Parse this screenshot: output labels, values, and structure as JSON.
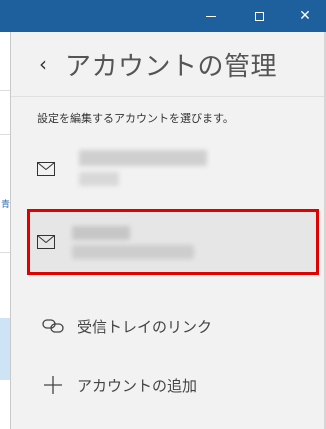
{
  "window": {
    "controls": {
      "minimize_icon": "minimize-icon",
      "maximize_icon": "maximize-icon",
      "close_glyph": "✕"
    },
    "titlebar_color": "#1e5f9e"
  },
  "left_strip": {
    "fragment_text": "青"
  },
  "header": {
    "back_glyph": "‹",
    "title": "アカウントの管理"
  },
  "instruction": "設定を編集するアカウントを選びます。",
  "accounts": [
    {
      "icon": "mail-icon",
      "selected": false
    },
    {
      "icon": "mail-icon",
      "selected": true
    }
  ],
  "actions": [
    {
      "icon": "link-icon",
      "label": "受信トレイのリンク"
    },
    {
      "icon": "plus-icon",
      "label": "アカウントの追加"
    }
  ],
  "highlight_color": "#e00000"
}
